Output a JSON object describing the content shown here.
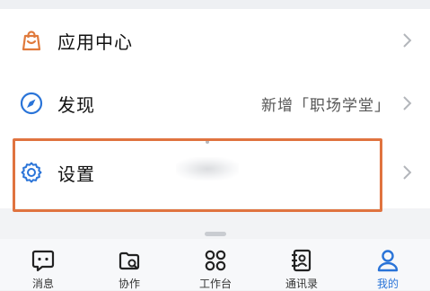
{
  "menu": {
    "items": [
      {
        "label": "应用中心",
        "value": ""
      },
      {
        "label": "发现",
        "value": "新增「职场学堂」"
      },
      {
        "label": "设置",
        "value": ""
      }
    ]
  },
  "tabbar": {
    "tabs": [
      {
        "label": "消息"
      },
      {
        "label": "协作"
      },
      {
        "label": "工作台"
      },
      {
        "label": "通讯录"
      },
      {
        "label": "我的"
      }
    ],
    "active": "我的"
  },
  "colors": {
    "accent": "#2a74d8",
    "highlight": "#e0733f",
    "bag_icon": "#e07a3c",
    "settings_icon": "#2a74d8"
  }
}
